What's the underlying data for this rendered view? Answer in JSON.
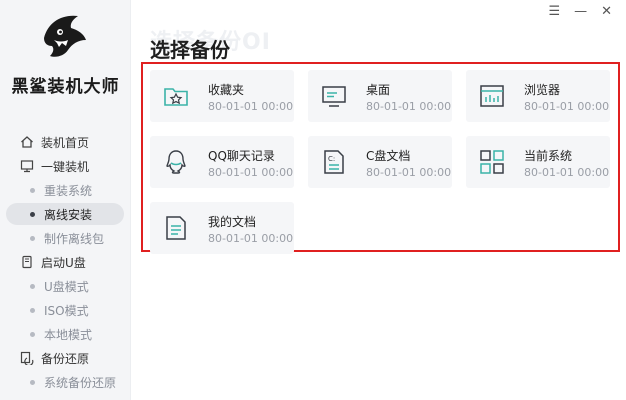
{
  "window": {
    "minimize": "—",
    "menu": "☰",
    "close": "✕"
  },
  "brand": {
    "name": "黑鲨装机大师"
  },
  "sidebar": {
    "items": [
      {
        "label": "装机首页",
        "kind": "group",
        "icon": "home-icon"
      },
      {
        "label": "一键装机",
        "kind": "group",
        "icon": "monitor-icon"
      },
      {
        "label": "重装系统",
        "kind": "sub"
      },
      {
        "label": "离线安装",
        "kind": "sub",
        "active": true
      },
      {
        "label": "制作离线包",
        "kind": "sub"
      },
      {
        "label": "启动U盘",
        "kind": "group",
        "icon": "usb-icon"
      },
      {
        "label": "U盘模式",
        "kind": "sub"
      },
      {
        "label": "ISO模式",
        "kind": "sub"
      },
      {
        "label": "本地模式",
        "kind": "sub"
      },
      {
        "label": "备份还原",
        "kind": "group",
        "icon": "backup-icon"
      },
      {
        "label": "系统备份还原",
        "kind": "sub"
      }
    ]
  },
  "main": {
    "watermark": "选择备份OI",
    "title": "选择备份",
    "cards": [
      {
        "name": "收藏夹",
        "date": "80-01-01 00:00",
        "icon": "favorites-icon"
      },
      {
        "name": "桌面",
        "date": "80-01-01 00:00",
        "icon": "desktop-icon"
      },
      {
        "name": "浏览器",
        "date": "80-01-01 00:00",
        "icon": "browser-icon"
      },
      {
        "name": "QQ聊天记录",
        "date": "80-01-01 00:00",
        "icon": "qq-icon"
      },
      {
        "name": "C盘文档",
        "date": "80-01-01 00:00",
        "icon": "c-drive-doc-icon"
      },
      {
        "name": "当前系统",
        "date": "80-01-01 00:00",
        "icon": "system-icon"
      },
      {
        "name": "我的文档",
        "date": "80-01-01 00:00",
        "icon": "my-documents-icon"
      }
    ]
  },
  "colors": {
    "accent": "#3bb3a8",
    "highlight_border": "#e02020",
    "card_bg": "#f5f6f8",
    "sidebar_bg": "#f4f5f7"
  }
}
